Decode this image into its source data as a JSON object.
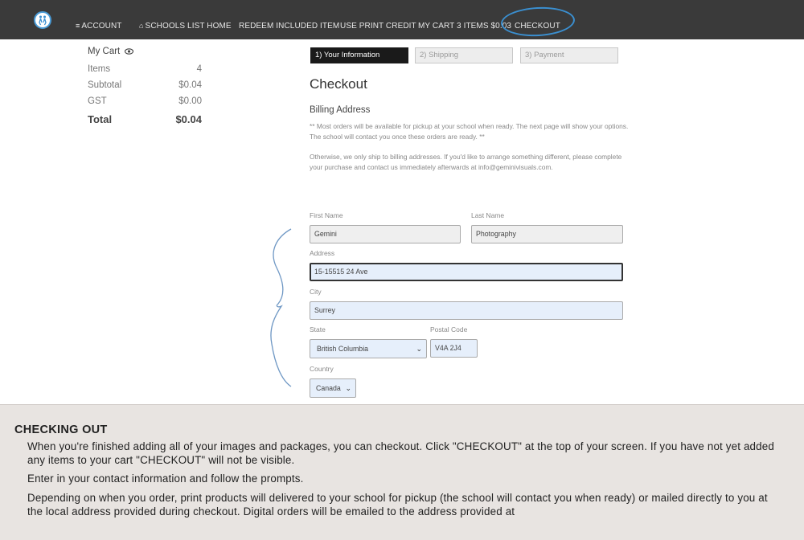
{
  "nav": {
    "account": "ACCOUNT",
    "account_icon": "≡",
    "schools_list_home": "SCHOOLS LIST HOME",
    "schools_icon": "⌂",
    "redeem": "REDEEM INCLUDED ITEM",
    "print_credit": "USE PRINT CREDIT",
    "my_cart": "MY CART 3 ITEMS $0.03",
    "checkout": "CHECKOUT",
    "highlight_color": "#3a8fd0"
  },
  "cart": {
    "title": "My Cart",
    "eye_icon": "eye-icon",
    "rows": [
      {
        "label": "Items",
        "value": "4"
      },
      {
        "label": "Subtotal",
        "value": "$0.04"
      },
      {
        "label": "GST",
        "value": "$0.00"
      }
    ],
    "total_label": "Total",
    "total_value": "$0.04"
  },
  "steps": [
    {
      "label": "1) Your Information",
      "active": true
    },
    {
      "label": "2) Shipping",
      "active": false
    },
    {
      "label": "3) Payment",
      "active": false
    }
  ],
  "checkout": {
    "heading": "Checkout",
    "billing_heading": "Billing Address",
    "note1": "** Most orders will be available for pickup at your school when ready. The next page will show your options. The school will contact you once these orders are ready. **",
    "note2": "Otherwise, we only ship to billing addresses. If you'd like to arrange something different, please complete your purchase and contact us immediately afterwards at info@geminivisuals.com."
  },
  "form": {
    "first_name_label": "First Name",
    "first_name": "Gemini",
    "last_name_label": "Last Name",
    "last_name": "Photography",
    "address_label": "Address",
    "address": "15-15515 24 Ave",
    "city_label": "City",
    "city": "Surrey",
    "state_label": "State",
    "state": "British Columbia",
    "postal_label": "Postal Code",
    "postal": "V4A 2J4",
    "country_label": "Country",
    "country": "Canada"
  },
  "instructions": {
    "title": "CHECKING OUT",
    "p1": "When you're finished adding all of your images and packages, you can checkout. Click \"CHECKOUT\" at the top of your screen. If you have not yet added any items to your cart \"CHECKOUT\" will not be visible.",
    "p2": "Enter in your contact information and follow the prompts.",
    "p3": "Depending on when you order, print products will delivered to your school for pickup (the school will contact you when ready) or mailed directly to you at the local address provided during checkout. Digital orders will be emailed to the address provided at"
  }
}
